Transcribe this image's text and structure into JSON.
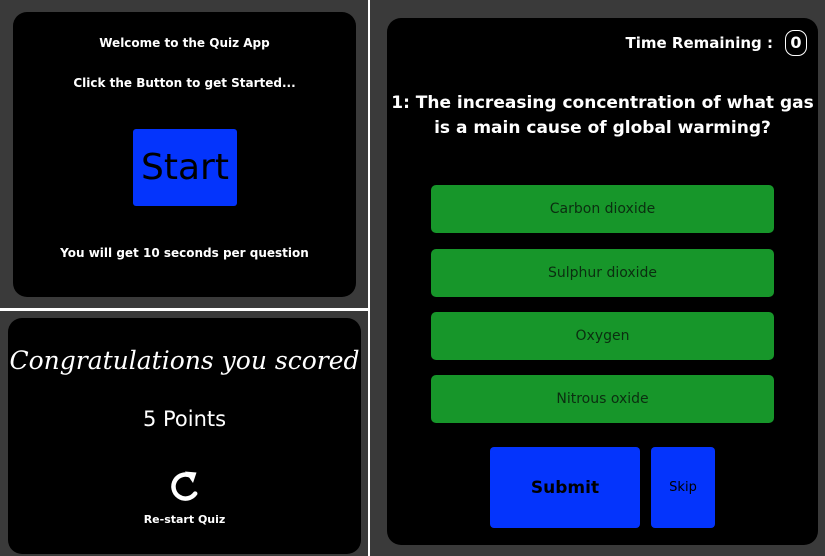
{
  "start_screen": {
    "welcome": "Welcome to the Quiz App",
    "instruction": "Click the Button to get Started...",
    "start_label": "Start",
    "note": "You will get 10 seconds per question"
  },
  "result_screen": {
    "congrats": "Congratulations you scored",
    "points": "5 Points",
    "restart_icon": "refresh-icon",
    "restart_label": "Re-start Quiz"
  },
  "quiz_screen": {
    "time_label": "Time Remaining :",
    "time_value": "0",
    "question": "1: The increasing concentration of what gas is a main cause of global warming?",
    "options": [
      {
        "label": "Carbon dioxide"
      },
      {
        "label": "Sulphur dioxide"
      },
      {
        "label": "Oxygen"
      },
      {
        "label": "Nitrous oxide"
      }
    ],
    "submit_label": "Submit",
    "skip_label": "Skip"
  },
  "colors": {
    "background": "#3a3a3a",
    "panel": "#000000",
    "primary_button": "#0434fc",
    "option_button": "#17962a",
    "text": "#ffffff"
  }
}
